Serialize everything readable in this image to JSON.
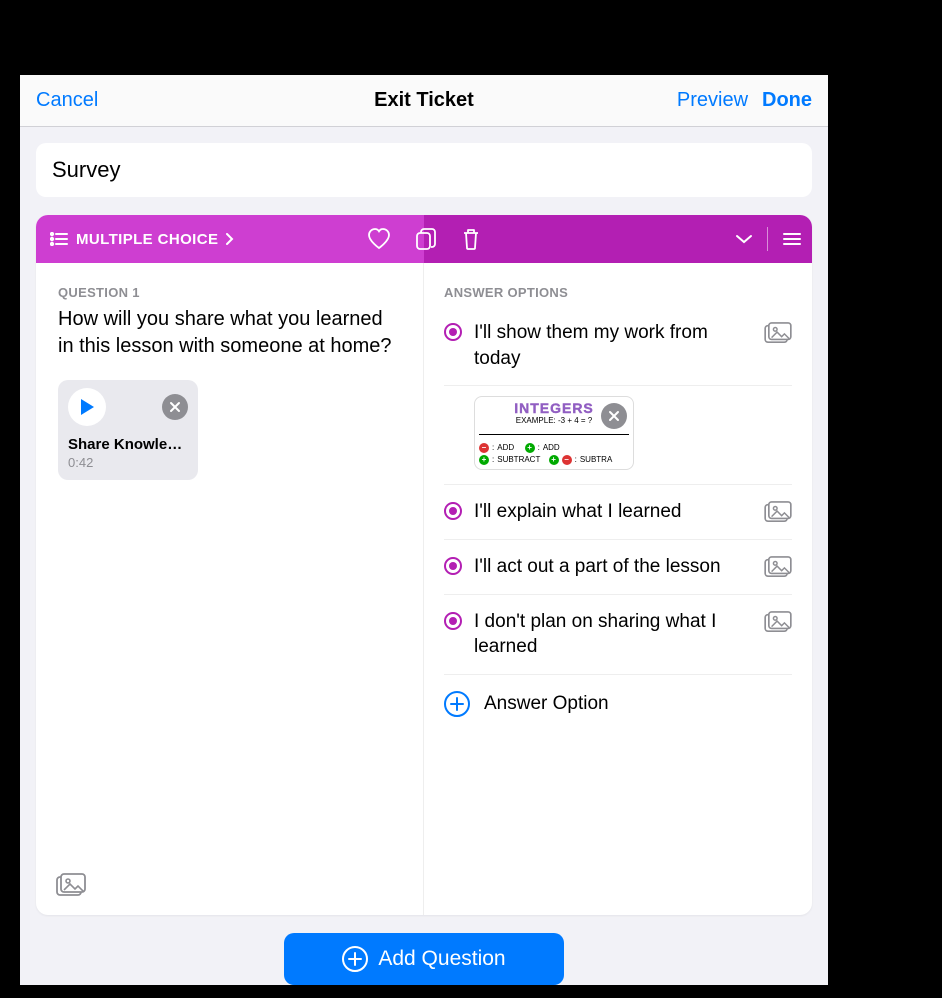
{
  "nav": {
    "cancel": "Cancel",
    "title": "Exit Ticket",
    "preview": "Preview",
    "done": "Done"
  },
  "survey_title": "Survey",
  "question": {
    "type_label": "MULTIPLE CHOICE",
    "number_label": "QUESTION 1",
    "text": "How will you share what you learned in this lesson with someone at home?",
    "attachment": {
      "title": "Share Knowled…",
      "duration": "0:42"
    },
    "answers_label": "ANSWER OPTIONS",
    "answers": [
      {
        "text": "I'll show them my work from today",
        "has_image": true
      },
      {
        "text": "I'll explain what I learned",
        "has_image": false
      },
      {
        "text": "I'll act out a part of the lesson",
        "has_image": false
      },
      {
        "text": "I don't plan on sharing what I learned",
        "has_image": false
      }
    ],
    "add_option_label": "Answer Option",
    "integer_sketch": {
      "title": "INTEGERS",
      "example": "EXAMPLE: -3 + 4 = ?",
      "rules": [
        "ADD",
        "ADD",
        "SUBTRACT",
        "SUBTRA"
      ]
    }
  },
  "add_question_label": "Add Question"
}
